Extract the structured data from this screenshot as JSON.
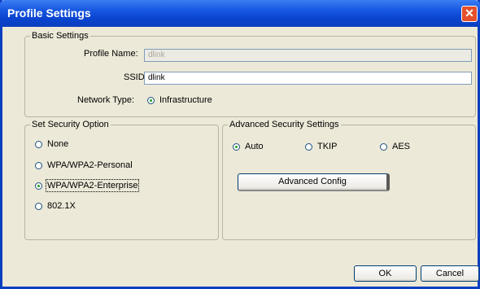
{
  "window": {
    "title": "Profile Settings",
    "close_glyph": "✕"
  },
  "basic": {
    "legend": "Basic Settings",
    "profile_name_label": "Profile Name:",
    "profile_name_value": "dlink",
    "ssid_label": "SSID:",
    "ssid_value": "dlink",
    "network_type_label": "Network Type:",
    "network_type_option": "Infrastructure"
  },
  "security": {
    "legend": "Set Security Option",
    "options": [
      {
        "label": "None",
        "selected": false
      },
      {
        "label": "WPA/WPA2-Personal",
        "selected": false
      },
      {
        "label": "WPA/WPA2-Enterprise",
        "selected": true
      },
      {
        "label": "802.1X",
        "selected": false
      }
    ]
  },
  "advanced": {
    "legend": "Advanced Security Settings",
    "options": [
      {
        "label": "Auto",
        "selected": true
      },
      {
        "label": "TKIP",
        "selected": false
      },
      {
        "label": "AES",
        "selected": false
      }
    ],
    "config_button": "Advanced Config"
  },
  "footer": {
    "ok": "OK",
    "cancel": "Cancel"
  }
}
